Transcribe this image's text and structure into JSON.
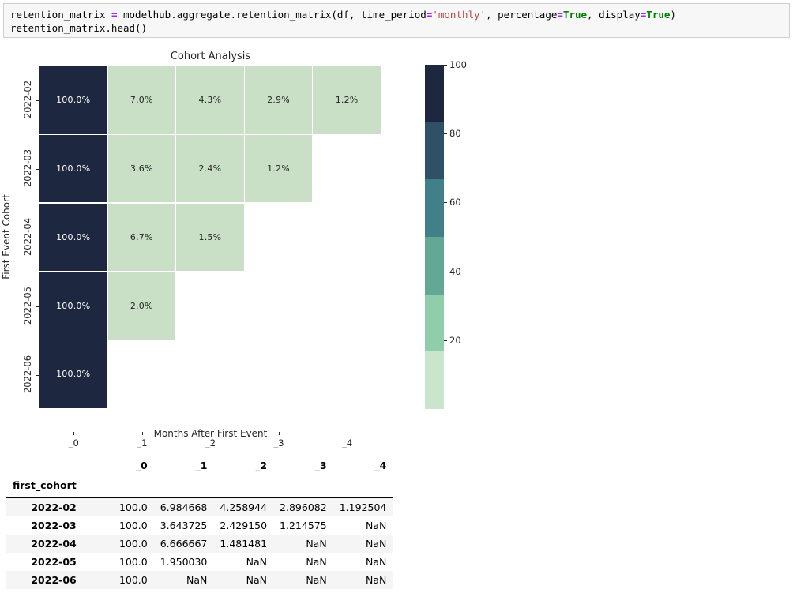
{
  "code_cell": {
    "lines": [
      [
        {
          "t": "retention_matrix ",
          "c": "plain"
        },
        {
          "t": "=",
          "c": "op"
        },
        {
          "t": " modelhub.aggregate.retention_matrix(df, time_period",
          "c": "plain"
        },
        {
          "t": "=",
          "c": "op"
        },
        {
          "t": "'monthly'",
          "c": "str"
        },
        {
          "t": ", percentage",
          "c": "plain"
        },
        {
          "t": "=",
          "c": "op"
        },
        {
          "t": "True",
          "c": "kw"
        },
        {
          "t": ", display",
          "c": "plain"
        },
        {
          "t": "=",
          "c": "op"
        },
        {
          "t": "True",
          "c": "kw"
        },
        {
          "t": ")",
          "c": "plain"
        }
      ],
      [
        {
          "t": "retention_matrix.head()",
          "c": "plain"
        }
      ]
    ]
  },
  "chart_data": {
    "type": "heatmap",
    "title": "Cohort Analysis",
    "xlabel": "Months After First Event",
    "ylabel": "First Event Cohort",
    "x_tick_labels": [
      "_0",
      "_1",
      "_2",
      "_3",
      "_4"
    ],
    "y_tick_labels": [
      "2022-02",
      "2022-03",
      "2022-04",
      "2022-05",
      "2022-06"
    ],
    "annotations": [
      [
        "100.0%",
        "7.0%",
        "4.3%",
        "2.9%",
        "1.2%"
      ],
      [
        "100.0%",
        "3.6%",
        "2.4%",
        "1.2%",
        null
      ],
      [
        "100.0%",
        "6.7%",
        "1.5%",
        null,
        null
      ],
      [
        "100.0%",
        "2.0%",
        null,
        null,
        null
      ],
      [
        "100.0%",
        null,
        null,
        null,
        null
      ]
    ],
    "values": [
      [
        100.0,
        6.984668,
        4.258944,
        2.896082,
        1.192504
      ],
      [
        100.0,
        3.643725,
        2.42915,
        1.214575,
        null
      ],
      [
        100.0,
        6.666667,
        1.481481,
        null,
        null
      ],
      [
        100.0,
        1.95003,
        null,
        null,
        null
      ],
      [
        100.0,
        null,
        null,
        null,
        null
      ]
    ],
    "cell_colors": [
      [
        "#1e2740",
        "#c9e0c6",
        "#c9e0c6",
        "#c9e0c6",
        "#c9e0c6"
      ],
      [
        "#1e2740",
        "#c9e0c6",
        "#c9e0c6",
        "#c9e0c6",
        null
      ],
      [
        "#1e2740",
        "#c9e0c6",
        "#c9e0c6",
        null,
        null
      ],
      [
        "#1e2740",
        "#c9e0c6",
        null,
        null,
        null
      ],
      [
        "#1e2740",
        null,
        null,
        null,
        null
      ]
    ],
    "cell_text_colors": [
      [
        "#ffffff",
        "#262626",
        "#262626",
        "#262626",
        "#262626"
      ],
      [
        "#ffffff",
        "#262626",
        "#262626",
        "#262626",
        null
      ],
      [
        "#ffffff",
        "#262626",
        "#262626",
        null,
        null
      ],
      [
        "#ffffff",
        "#262626",
        null,
        null,
        null
      ],
      [
        "#ffffff",
        null,
        null,
        null,
        null
      ]
    ],
    "grid": false,
    "colorbar": {
      "vmin": 0,
      "vmax": 100,
      "tick_values": [
        100,
        80,
        60,
        40,
        20
      ],
      "tick_labels": [
        "100",
        "80",
        "60",
        "40",
        "20"
      ],
      "bands": [
        {
          "from": 100,
          "to": 83.3,
          "color": "#1e2740"
        },
        {
          "from": 83.3,
          "to": 66.7,
          "color": "#2f5066"
        },
        {
          "from": 66.7,
          "to": 50.0,
          "color": "#428089"
        },
        {
          "from": 50.0,
          "to": 33.3,
          "color": "#63a894"
        },
        {
          "from": 33.3,
          "to": 16.7,
          "color": "#90cdab"
        },
        {
          "from": 16.7,
          "to": 0,
          "color": "#c9e5cc"
        }
      ]
    }
  },
  "dataframe": {
    "index_name": "first_cohort",
    "columns": [
      "_0",
      "_1",
      "_2",
      "_3",
      "_4"
    ],
    "rows": [
      {
        "index": "2022-02",
        "cells": [
          "100.0",
          "6.984668",
          "4.258944",
          "2.896082",
          "1.192504"
        ]
      },
      {
        "index": "2022-03",
        "cells": [
          "100.0",
          "3.643725",
          "2.429150",
          "1.214575",
          "NaN"
        ]
      },
      {
        "index": "2022-04",
        "cells": [
          "100.0",
          "6.666667",
          "1.481481",
          "NaN",
          "NaN"
        ]
      },
      {
        "index": "2022-05",
        "cells": [
          "100.0",
          "1.950030",
          "NaN",
          "NaN",
          "NaN"
        ]
      },
      {
        "index": "2022-06",
        "cells": [
          "100.0",
          "NaN",
          "NaN",
          "NaN",
          "NaN"
        ]
      }
    ]
  }
}
